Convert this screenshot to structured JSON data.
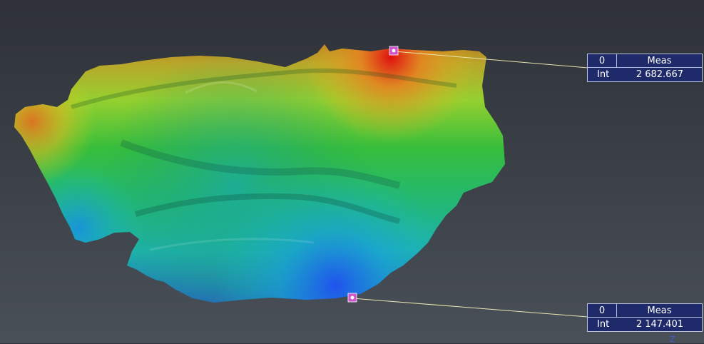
{
  "scene": {
    "name": "terrain-heightmap-3d"
  },
  "points": [
    {
      "id": "0",
      "col_header": "Meas",
      "row_header": "Int",
      "value": "2 682.667"
    },
    {
      "id": "0",
      "col_header": "Meas",
      "row_header": "Int",
      "value": "2 147.401"
    }
  ],
  "axis": {
    "label": "Z"
  },
  "colors": {
    "label_bg": "#1e2a6a",
    "label_border": "#b8c0e0",
    "leader": "#e8e6b0",
    "marker": "#cc55cc"
  }
}
